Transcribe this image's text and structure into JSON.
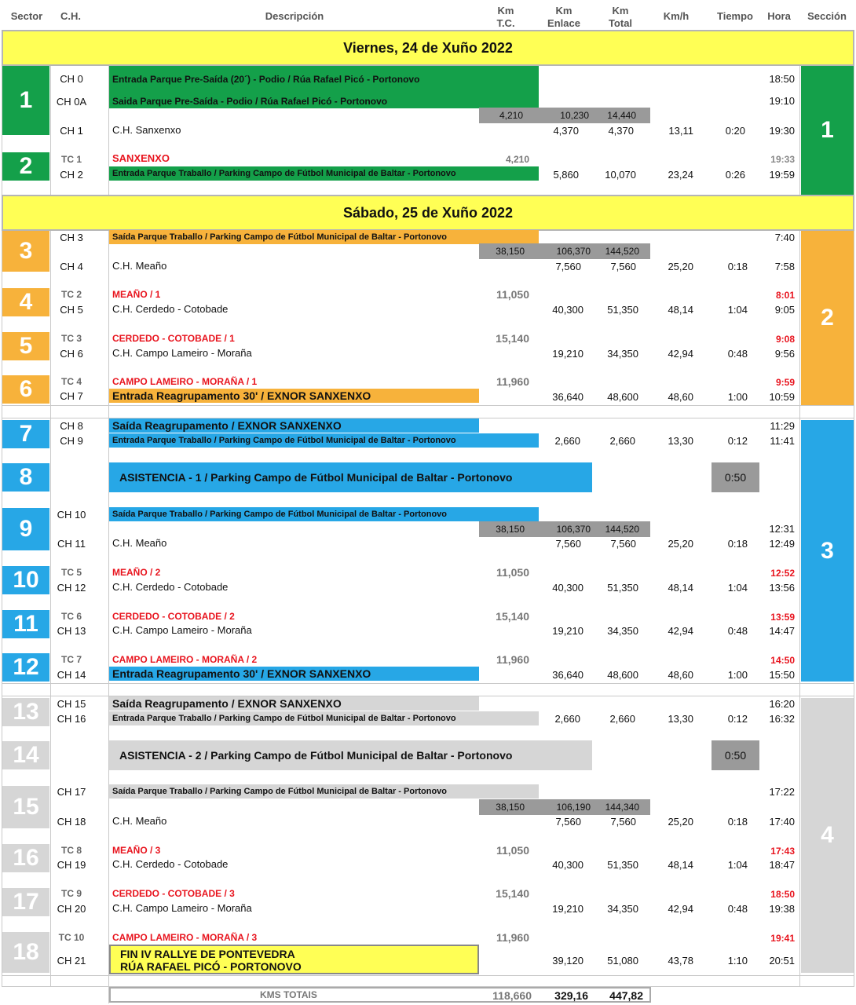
{
  "headers": {
    "sector": "Sector",
    "ch": "C.H.",
    "descripcion": "Descripción",
    "km_tc": [
      "Km",
      "T.C."
    ],
    "km_enlace": [
      "Km",
      "Enlace"
    ],
    "km_total": [
      "Km",
      "Total"
    ],
    "kmh": "Km/h",
    "tiempo": "Tiempo",
    "hora": "Hora",
    "seccion": "Sección"
  },
  "days": [
    "Viernes, 24 de Xuño 2022",
    "Sábado, 25 de Xuño 2022"
  ],
  "colors": {
    "green": "#14a04a",
    "orange": "#f7b23b",
    "blue": "#27a7e6",
    "gray": "#d6d6d6",
    "yellow": "#ffff55",
    "red": "#e8141e"
  },
  "sectors": [
    "1",
    "2",
    "3",
    "4",
    "5",
    "6",
    "7",
    "8",
    "9",
    "10",
    "11",
    "12",
    "13",
    "14",
    "15",
    "16",
    "17",
    "18"
  ],
  "sections": [
    "1",
    "2",
    "3",
    "4"
  ],
  "rows": [
    {
      "ch": "CH 0",
      "desc": "Entrada Parque Pre-Saída (20´) - Podio / Rúa Rafael Picó - Portonovo",
      "hora": "18:50"
    },
    {
      "ch": "CH 0A",
      "desc": "Saida Parque Pre-Saída - Podio / Rúa Rafael Picó - Portonovo",
      "hora": "19:10"
    },
    {
      "ch": "CH 1",
      "desc": "C.H. Sanxenxo",
      "enlace": "4,370",
      "total": "4,370",
      "kmh": "13,11",
      "tiempo": "0:20",
      "hora": "19:30"
    },
    {
      "ch": "TC 1",
      "desc": "SANXENXO",
      "tc": "4,210",
      "hora": "19:33"
    },
    {
      "ch": "CH 2",
      "desc": "Entrada Parque Traballo / Parking Campo de Fútbol Municipal de Baltar - Portonovo",
      "enlace": "5,860",
      "total": "10,070",
      "kmh": "23,24",
      "tiempo": "0:26",
      "hora": "19:59"
    },
    {
      "ch": "CH 3",
      "desc": "Saída Parque Traballo / Parking Campo de Fútbol Municipal de Baltar - Portonovo",
      "hora": "7:40"
    },
    {
      "ch": "CH 4",
      "desc": "C.H. Meaño",
      "enlace": "7,560",
      "total": "7,560",
      "kmh": "25,20",
      "tiempo": "0:18",
      "hora": "7:58"
    },
    {
      "ch": "TC 2",
      "desc": "MEAÑO / 1",
      "tc": "11,050",
      "hora": "8:01"
    },
    {
      "ch": "CH 5",
      "desc": "C.H. Cerdedo - Cotobade",
      "enlace": "40,300",
      "total": "51,350",
      "kmh": "48,14",
      "tiempo": "1:04",
      "hora": "9:05"
    },
    {
      "ch": "TC 3",
      "desc": "CERDEDO - COTOBADE / 1",
      "tc": "15,140",
      "hora": "9:08"
    },
    {
      "ch": "CH 6",
      "desc": "C.H. Campo Lameiro - Moraña",
      "enlace": "19,210",
      "total": "34,350",
      "kmh": "42,94",
      "tiempo": "0:48",
      "hora": "9:56"
    },
    {
      "ch": "TC 4",
      "desc": "CAMPO LAMEIRO - MORAÑA / 1",
      "tc": "11,960",
      "hora": "9:59"
    },
    {
      "ch": "CH 7",
      "desc": "Entrada Reagrupamento 30' / EXNOR SANXENXO",
      "enlace": "36,640",
      "total": "48,600",
      "kmh": "48,60",
      "tiempo": "1:00",
      "hora": "10:59"
    },
    {
      "ch": "CH 8",
      "desc": "Saída Reagrupamento / EXNOR SANXENXO",
      "hora": "11:29"
    },
    {
      "ch": "CH 9",
      "desc": "Entrada Parque Traballo / Parking Campo de Fútbol Municipal de Baltar - Portonovo",
      "enlace": "2,660",
      "total": "2,660",
      "kmh": "13,30",
      "tiempo": "0:12",
      "hora": "11:41"
    },
    {
      "desc": "ASISTENCIA - 1 / Parking Campo de Fútbol Municipal de Baltar - Portonovo",
      "tiempo": "0:50"
    },
    {
      "ch": "CH 10",
      "desc": "Saída Parque Traballo / Parking Campo de Fútbol Municipal de Baltar - Portonovo",
      "hora": "12:31"
    },
    {
      "ch": "CH 11",
      "desc": "C.H. Meaño",
      "enlace": "7,560",
      "total": "7,560",
      "kmh": "25,20",
      "tiempo": "0:18",
      "hora": "12:49"
    },
    {
      "ch": "TC 5",
      "desc": "MEAÑO / 2",
      "tc": "11,050",
      "hora": "12:52"
    },
    {
      "ch": "CH 12",
      "desc": "C.H. Cerdedo - Cotobade",
      "enlace": "40,300",
      "total": "51,350",
      "kmh": "48,14",
      "tiempo": "1:04",
      "hora": "13:56"
    },
    {
      "ch": "TC 6",
      "desc": "CERDEDO - COTOBADE / 2",
      "tc": "15,140",
      "hora": "13:59"
    },
    {
      "ch": "CH 13",
      "desc": "C.H. Campo Lameiro - Moraña",
      "enlace": "19,210",
      "total": "34,350",
      "kmh": "42,94",
      "tiempo": "0:48",
      "hora": "14:47"
    },
    {
      "ch": "TC 7",
      "desc": "CAMPO LAMEIRO - MORAÑA / 2",
      "tc": "11,960",
      "hora": "14:50"
    },
    {
      "ch": "CH 14",
      "desc": "Entrada Reagrupamento 30' / EXNOR SANXENXO",
      "enlace": "36,640",
      "total": "48,600",
      "kmh": "48,60",
      "tiempo": "1:00",
      "hora": "15:50"
    },
    {
      "ch": "CH 15",
      "desc": "Saída Reagrupamento / EXNOR SANXENXO",
      "hora": "16:20"
    },
    {
      "ch": "CH 16",
      "desc": "Entrada Parque Traballo / Parking Campo de Fútbol Municipal de Baltar - Portonovo",
      "enlace": "2,660",
      "total": "2,660",
      "kmh": "13,30",
      "tiempo": "0:12",
      "hora": "16:32"
    },
    {
      "desc": "ASISTENCIA - 2 / Parking Campo de Fútbol Municipal de Baltar - Portonovo",
      "tiempo": "0:50"
    },
    {
      "ch": "CH 17",
      "desc": "Saída Parque Traballo / Parking Campo de Fútbol Municipal de Baltar - Portonovo",
      "hora": "17:22"
    },
    {
      "ch": "CH 18",
      "desc": "C.H. Meaño",
      "enlace": "7,560",
      "total": "7,560",
      "kmh": "25,20",
      "tiempo": "0:18",
      "hora": "17:40"
    },
    {
      "ch": "TC 8",
      "desc": "MEAÑO / 3",
      "tc": "11,050",
      "hora": "17:43"
    },
    {
      "ch": "CH 19",
      "desc": "C.H. Cerdedo - Cotobade",
      "enlace": "40,300",
      "total": "51,350",
      "kmh": "48,14",
      "tiempo": "1:04",
      "hora": "18:47"
    },
    {
      "ch": "TC 9",
      "desc": "CERDEDO - COTOBADE / 3",
      "tc": "15,140",
      "hora": "18:50"
    },
    {
      "ch": "CH 20",
      "desc": "C.H. Campo Lameiro - Moraña",
      "enlace": "19,210",
      "total": "34,350",
      "kmh": "42,94",
      "tiempo": "0:48",
      "hora": "19:38"
    },
    {
      "ch": "TC 10",
      "desc": "CAMPO LAMEIRO - MORAÑA / 3",
      "tc": "11,960",
      "hora": "19:41"
    },
    {
      "ch": "CH 21",
      "desc": [
        "FIN IV RALLYE DE PONTEVEDRA",
        "RÚA RAFAEL PICÓ - PORTONOVO"
      ],
      "enlace": "39,120",
      "total": "51,080",
      "kmh": "43,78",
      "tiempo": "1:10",
      "hora": "20:51"
    }
  ],
  "subtotals": [
    [
      "4,210",
      "10,230",
      "14,440"
    ],
    [
      "38,150",
      "106,370",
      "144,520"
    ],
    [
      "38,150",
      "106,370",
      "144,520"
    ],
    [
      "38,150",
      "106,190",
      "144,340"
    ]
  ],
  "totals": {
    "label": "KMS TOTAIS",
    "tc": "118,660",
    "enlace": "329,16",
    "total": "447,82"
  }
}
